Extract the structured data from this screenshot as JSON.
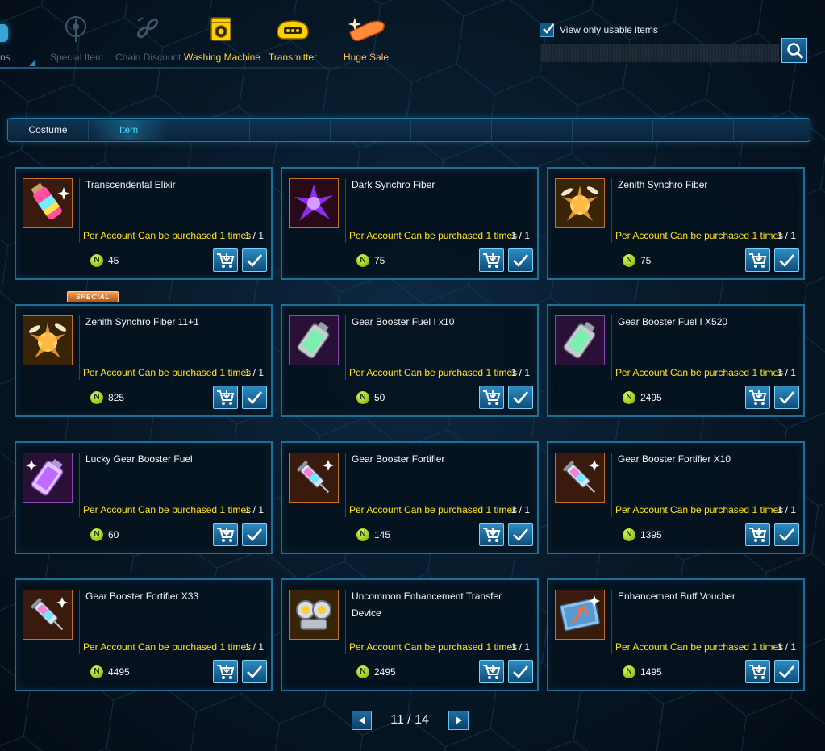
{
  "top_tabs": [
    {
      "label": "Special Item",
      "icon": "special-item-icon",
      "state": "dim"
    },
    {
      "label": "Chain Discount",
      "icon": "chain-discount-icon",
      "state": "dim"
    },
    {
      "label": "Washing Machine",
      "icon": "washing-machine-icon",
      "state": "yellow"
    },
    {
      "label": "Transmitter",
      "icon": "transmitter-icon",
      "state": "yellow"
    },
    {
      "label": "Huge Sale",
      "icon": "huge-sale-icon",
      "state": "orange"
    }
  ],
  "partial_tab_label": "ns",
  "filter": {
    "usable_label": "View only usable items",
    "usable_checked": true
  },
  "search": {
    "value": "",
    "placeholder": ""
  },
  "categories": [
    {
      "label": "Costume",
      "active": false
    },
    {
      "label": "Item",
      "active": true
    },
    {
      "label": "",
      "active": false
    },
    {
      "label": "",
      "active": false
    },
    {
      "label": "",
      "active": false
    },
    {
      "label": "",
      "active": false
    },
    {
      "label": "",
      "active": false
    },
    {
      "label": "",
      "active": false
    },
    {
      "label": "",
      "active": false
    },
    {
      "label": "",
      "active": false
    }
  ],
  "items": [
    {
      "name": "Transcendental Elixir",
      "limit": "Per Account Can be purchased 1 times",
      "count": "1 / 1",
      "price": "45",
      "icon": "elixir-bottle-icon",
      "special": false
    },
    {
      "name": "Dark Synchro Fiber",
      "limit": "Per Account Can be purchased 1 times",
      "count": "1 / 1",
      "price": "75",
      "icon": "dark-fiber-icon",
      "special": false
    },
    {
      "name": "Zenith Synchro Fiber",
      "limit": "Per Account Can be purchased 1 times",
      "count": "1 / 1",
      "price": "75",
      "icon": "zenith-fiber-icon",
      "special": false
    },
    {
      "name": "Zenith Synchro Fiber 11+1",
      "limit": "Per Account Can be purchased 1 times",
      "count": "1 / 1",
      "price": "825",
      "icon": "zenith-fiber-icon",
      "special": true,
      "special_label": "SPECIAL"
    },
    {
      "name": "Gear Booster Fuel I x10",
      "limit": "Per Account Can be purchased 1 times",
      "count": "1 / 1",
      "price": "50",
      "icon": "fuel-canister-icon",
      "special": false
    },
    {
      "name": "Gear Booster Fuel I X520",
      "limit": "Per Account Can be purchased 1 times",
      "count": "1 / 1",
      "price": "2495",
      "icon": "fuel-canister-icon",
      "special": false
    },
    {
      "name": "Lucky Gear Booster Fuel",
      "limit": "Per Account Can be purchased 1 times",
      "count": "1 / 1",
      "price": "60",
      "icon": "lucky-fuel-icon",
      "special": false
    },
    {
      "name": "Gear Booster Fortifier",
      "limit": "Per Account Can be purchased 1 times",
      "count": "1 / 1",
      "price": "145",
      "icon": "syringe-icon",
      "special": false
    },
    {
      "name": "Gear Booster Fortifier X10",
      "limit": "Per Account Can be purchased 1 times",
      "count": "1 / 1",
      "price": "1395",
      "icon": "syringe-icon",
      "special": false
    },
    {
      "name": "Gear Booster Fortifier X33",
      "limit": "Per Account Can be purchased 1 times",
      "count": "1 / 1",
      "price": "4495",
      "icon": "syringe-icon",
      "special": false
    },
    {
      "name": "Uncommon Enhancement Transfer Device",
      "limit": "Per Account Can be purchased 1 times",
      "count": "1 / 1",
      "price": "2495",
      "icon": "transfer-device-icon",
      "special": false
    },
    {
      "name": "Enhancement Buff Voucher",
      "limit": "Per Account Can be purchased 1 times",
      "count": "1 / 1",
      "price": "1495",
      "icon": "buff-voucher-icon",
      "special": false
    }
  ],
  "currency_symbol": "N",
  "pagination": {
    "text": "11 / 14",
    "current": 11,
    "total": 14
  },
  "colors": {
    "limit_text": "#ffe21f",
    "active_tab": "#4fd6ff",
    "card_border": "#1d6f98",
    "coin": "#a8d41a"
  }
}
